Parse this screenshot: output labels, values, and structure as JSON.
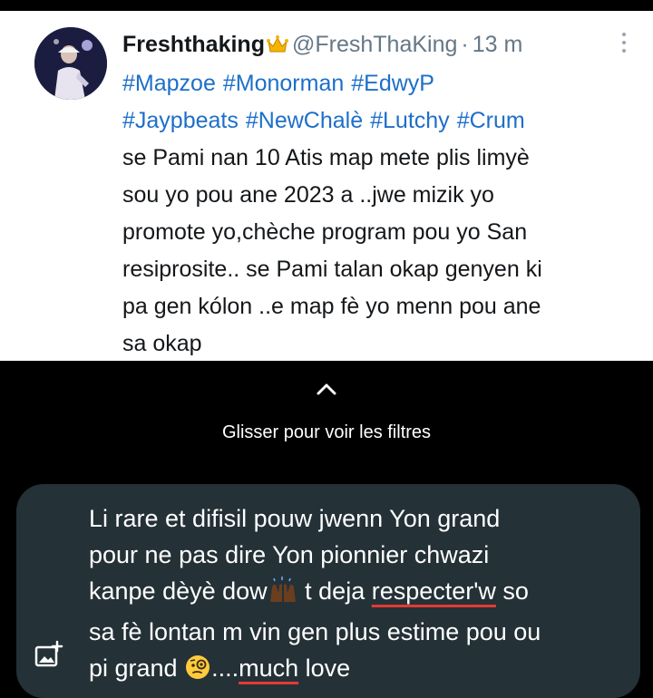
{
  "tweet": {
    "display_name": "Freshthaking",
    "handle": "@FreshThaKing",
    "separator": "·",
    "time": "13 m",
    "hashtags_line1": [
      "#Mapzoe",
      "#Monorman",
      "#EdwyP"
    ],
    "hashtags_line2": [
      "#Jaypbeats",
      "#NewChalè",
      "#Lutchy",
      "#Crum"
    ],
    "body_lines": [
      "se Pami nan 10 Atis map mete plis limyè",
      "sou yo pou ane 2023 a ..jwe mizik yo",
      "promote yo,chèche program pou yo San",
      "resiprosite.. se Pami talan okap genyen ki",
      "pa gen kólon ..e map fè yo menn pou ane",
      "sa okap"
    ]
  },
  "filter_hint": "Glisser pour voir les filtres",
  "caption": {
    "line1": "Li rare et difisil pouw jwenn Yon grand",
    "line2": "pour ne pas dire Yon pionnier chwazi",
    "line3_before": "kanpe dèyè dow",
    "line3_mid": " t deja ",
    "line3_misspelled": "respecter'w",
    "line3_after": " so",
    "line4": "sa fè lontan m vin gen plus estime pou ou",
    "line5_before": "pi grand ",
    "line5_dots": "....",
    "line5_misspelled": "much",
    "line5_after": " love"
  },
  "icons": {
    "more": "more-vertical-icon",
    "crown": "crown-emoji-icon",
    "chevron": "chevron-up-icon",
    "add_photo": "add-photo-icon",
    "raised_hands": "raised-hands-emoji-icon",
    "face": "face-with-monocle-emoji-icon"
  },
  "colors": {
    "hashtag": "#1d6fc9",
    "caption_bg": "#243137",
    "spellcheck_underline": "#e53935"
  }
}
